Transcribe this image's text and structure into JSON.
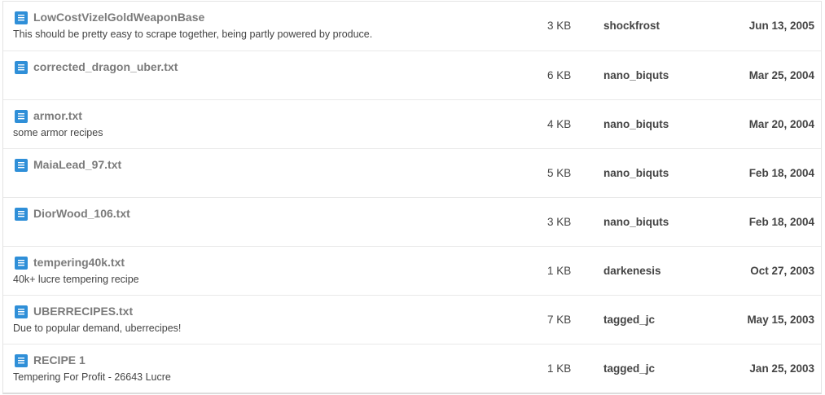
{
  "files": [
    {
      "name": "LowCostVizelGoldWeaponBase",
      "description": "This should be pretty easy to scrape together, being partly powered by produce.",
      "size": "3 KB",
      "author": "shockfrost",
      "date": "Jun 13, 2005"
    },
    {
      "name": "corrected_dragon_uber.txt",
      "description": "",
      "size": "6 KB",
      "author": "nano_biquts",
      "date": "Mar 25, 2004"
    },
    {
      "name": "armor.txt",
      "description": "some armor recipes",
      "size": "4 KB",
      "author": "nano_biquts",
      "date": "Mar 20, 2004"
    },
    {
      "name": "MaiaLead_97.txt",
      "description": "",
      "size": "5 KB",
      "author": "nano_biquts",
      "date": "Feb 18, 2004"
    },
    {
      "name": "DiorWood_106.txt",
      "description": "",
      "size": "3 KB",
      "author": "nano_biquts",
      "date": "Feb 18, 2004"
    },
    {
      "name": "tempering40k.txt",
      "description": "40k+ lucre tempering recipe",
      "size": "1 KB",
      "author": "darkenesis",
      "date": "Oct 27, 2003"
    },
    {
      "name": "UBERRECIPES.txt",
      "description": "Due to popular demand, uberrecipes!",
      "size": "7 KB",
      "author": "tagged_jc",
      "date": "May 15, 2003"
    },
    {
      "name": "RECIPE 1",
      "description": "Tempering For Profit - 26643 Lucre",
      "size": "1 KB",
      "author": "tagged_jc",
      "date": "Jan 25, 2003"
    }
  ],
  "colors": {
    "icon": "#2f8fd8",
    "file_name": "#7b7b7b",
    "text": "#444444",
    "row_border": "#e9e9e9"
  },
  "icons": {
    "file": "document-icon"
  }
}
